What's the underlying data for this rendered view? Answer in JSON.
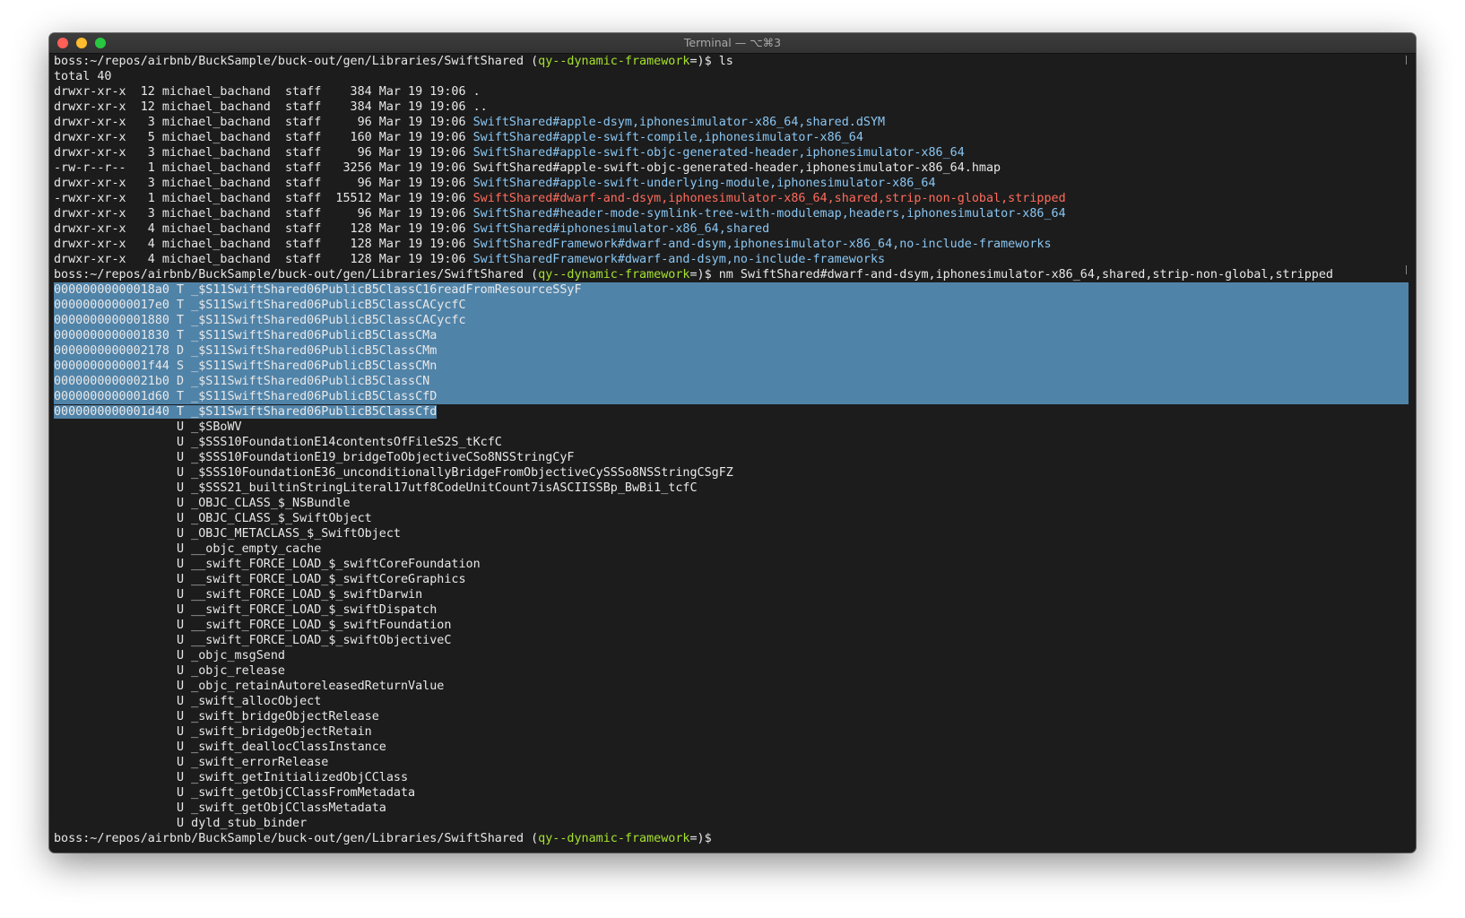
{
  "window": {
    "title": "Terminal — ⌥⌘3"
  },
  "colors": {
    "background": "#1c1c1c",
    "text": "#e8e8e8",
    "dir": "#8ac6f2",
    "exec": "#ff6b5c",
    "branch": "#a6e22e",
    "selection": "#5083a8"
  },
  "prompt": {
    "path": "boss:~/repos/airbnb/BuckSample/buck-out/gen/Libraries/SwiftShared (",
    "branch": "qy--dynamic-framework",
    "suffix": "=)$ "
  },
  "commands": {
    "first": "ls",
    "second": "nm SwiftShared#dwarf-and-dsym,iphonesimulator-x86_64,shared,strip-non-global,stripped"
  },
  "ls_output": {
    "total": "total 40",
    "entries": [
      {
        "meta": "drwxr-xr-x  12 michael_bachand  staff    384 Mar 19 19:06 ",
        "name": ".",
        "color": "default"
      },
      {
        "meta": "drwxr-xr-x  12 michael_bachand  staff    384 Mar 19 19:06 ",
        "name": "..",
        "color": "default"
      },
      {
        "meta": "drwxr-xr-x   3 michael_bachand  staff     96 Mar 19 19:06 ",
        "name": "SwiftShared#apple-dsym,iphonesimulator-x86_64,shared.dSYM",
        "color": "blue"
      },
      {
        "meta": "drwxr-xr-x   5 michael_bachand  staff    160 Mar 19 19:06 ",
        "name": "SwiftShared#apple-swift-compile,iphonesimulator-x86_64",
        "color": "blue"
      },
      {
        "meta": "drwxr-xr-x   3 michael_bachand  staff     96 Mar 19 19:06 ",
        "name": "SwiftShared#apple-swift-objc-generated-header,iphonesimulator-x86_64",
        "color": "blue"
      },
      {
        "meta": "-rw-r--r--   1 michael_bachand  staff   3256 Mar 19 19:06 ",
        "name": "SwiftShared#apple-swift-objc-generated-header,iphonesimulator-x86_64.hmap",
        "color": "default"
      },
      {
        "meta": "drwxr-xr-x   3 michael_bachand  staff     96 Mar 19 19:06 ",
        "name": "SwiftShared#apple-swift-underlying-module,iphonesimulator-x86_64",
        "color": "blue"
      },
      {
        "meta": "-rwxr-xr-x   1 michael_bachand  staff  15512 Mar 19 19:06 ",
        "name": "SwiftShared#dwarf-and-dsym,iphonesimulator-x86_64,shared,strip-non-global,stripped",
        "color": "red"
      },
      {
        "meta": "drwxr-xr-x   3 michael_bachand  staff     96 Mar 19 19:06 ",
        "name": "SwiftShared#header-mode-symlink-tree-with-modulemap,headers,iphonesimulator-x86_64",
        "color": "blue"
      },
      {
        "meta": "drwxr-xr-x   4 michael_bachand  staff    128 Mar 19 19:06 ",
        "name": "SwiftShared#iphonesimulator-x86_64,shared",
        "color": "blue"
      },
      {
        "meta": "drwxr-xr-x   4 michael_bachand  staff    128 Mar 19 19:06 ",
        "name": "SwiftSharedFramework#dwarf-and-dsym,iphonesimulator-x86_64,no-include-frameworks",
        "color": "blue"
      },
      {
        "meta": "drwxr-xr-x   4 michael_bachand  staff    128 Mar 19 19:06 ",
        "name": "SwiftSharedFramework#dwarf-and-dsym,no-include-frameworks",
        "color": "blue"
      }
    ]
  },
  "nm_output": {
    "defined": [
      "00000000000018a0 T _$S11SwiftShared06PublicB5ClassC16readFromResourceSSyF",
      "00000000000017e0 T _$S11SwiftShared06PublicB5ClassCACycfC",
      "0000000000001880 T _$S11SwiftShared06PublicB5ClassCACycfc",
      "0000000000001830 T _$S11SwiftShared06PublicB5ClassCMa",
      "0000000000002178 D _$S11SwiftShared06PublicB5ClassCMm",
      "0000000000001f44 S _$S11SwiftShared06PublicB5ClassCMn",
      "00000000000021b0 D _$S11SwiftShared06PublicB5ClassCN",
      "0000000000001d60 T _$S11SwiftShared06PublicB5ClassCfD",
      "0000000000001d40 T _$S11SwiftShared06PublicB5ClassCfd"
    ],
    "undefined": [
      "                 U _$SBoWV",
      "                 U _$SSS10FoundationE14contentsOfFileS2S_tKcfC",
      "                 U _$SSS10FoundationE19_bridgeToObjectiveCSo8NSStringCyF",
      "                 U _$SSS10FoundationE36_unconditionallyBridgeFromObjectiveCySSSo8NSStringCSgFZ",
      "                 U _$SSS21_builtinStringLiteral17utf8CodeUnitCount7isASCIISSBp_BwBi1_tcfC",
      "                 U _OBJC_CLASS_$_NSBundle",
      "                 U _OBJC_CLASS_$_SwiftObject",
      "                 U _OBJC_METACLASS_$_SwiftObject",
      "                 U __objc_empty_cache",
      "                 U __swift_FORCE_LOAD_$_swiftCoreFoundation",
      "                 U __swift_FORCE_LOAD_$_swiftCoreGraphics",
      "                 U __swift_FORCE_LOAD_$_swiftDarwin",
      "                 U __swift_FORCE_LOAD_$_swiftDispatch",
      "                 U __swift_FORCE_LOAD_$_swiftFoundation",
      "                 U __swift_FORCE_LOAD_$_swiftObjectiveC",
      "                 U _objc_msgSend",
      "                 U _objc_release",
      "                 U _objc_retainAutoreleasedReturnValue",
      "                 U _swift_allocObject",
      "                 U _swift_bridgeObjectRelease",
      "                 U _swift_bridgeObjectRetain",
      "                 U _swift_deallocClassInstance",
      "                 U _swift_errorRelease",
      "                 U _swift_getInitializedObjCClass",
      "                 U _swift_getObjCClassFromMetadata",
      "                 U _swift_getObjCClassMetadata",
      "                 U dyld_stub_binder"
    ]
  }
}
